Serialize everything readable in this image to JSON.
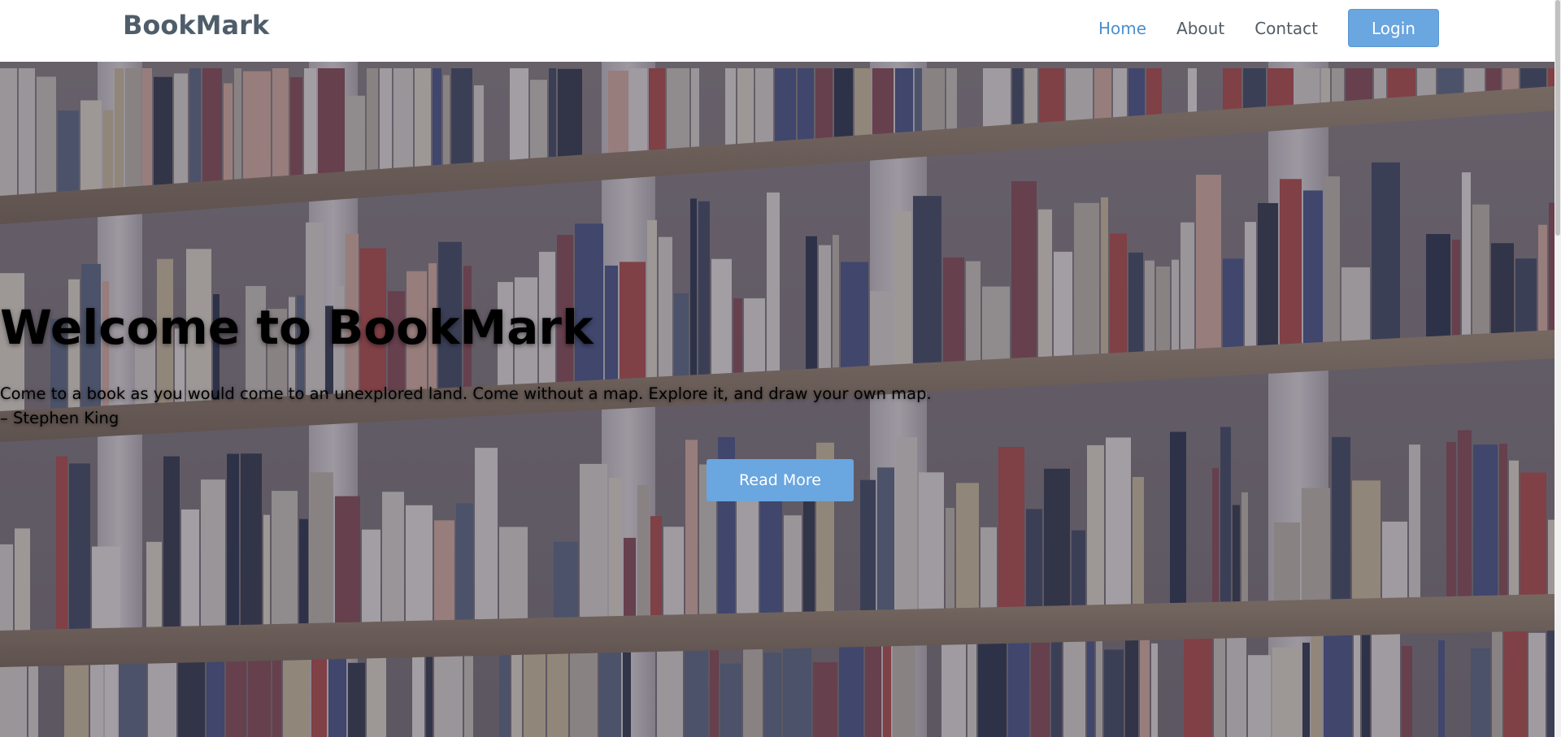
{
  "navbar": {
    "brand": "BookMark",
    "links": [
      {
        "label": "Home",
        "active": true
      },
      {
        "label": "About",
        "active": false
      },
      {
        "label": "Contact",
        "active": false
      }
    ],
    "login_label": "Login"
  },
  "hero": {
    "title": "Welcome to BookMark",
    "quote_line1": "Come to a book as you would come to an unexplored land. Come without a map. Explore it, and draw your own map.",
    "quote_line2": "– Stephen King",
    "button_label": "Read More",
    "background_image": "bookshelf-photo"
  },
  "colors": {
    "accent": "#6aa6df",
    "active_link": "#4c8fce",
    "brand_text": "#4f5d6b",
    "nav_text": "#525c66"
  }
}
